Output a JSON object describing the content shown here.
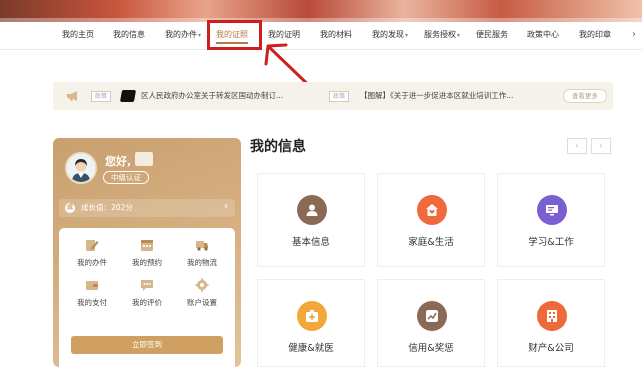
{
  "nav": {
    "items": [
      {
        "label": "我的主页",
        "dropdown": false
      },
      {
        "label": "我的信息",
        "dropdown": false
      },
      {
        "label": "我的办件",
        "dropdown": true
      },
      {
        "label": "我的证照",
        "dropdown": false,
        "active": true
      },
      {
        "label": "我的证明",
        "dropdown": false
      },
      {
        "label": "我的材料",
        "dropdown": false
      },
      {
        "label": "我的发现",
        "dropdown": true
      },
      {
        "label": "服务授权",
        "dropdown": true
      },
      {
        "label": "便民服务",
        "dropdown": false
      },
      {
        "label": "政策中心",
        "dropdown": false
      },
      {
        "label": "我的印章",
        "dropdown": false
      }
    ],
    "next": "›"
  },
  "notice": {
    "items": [
      {
        "tag": "政策",
        "text": "区人民政府办公室关于转发区国动办制订..."
      },
      {
        "tag": "政策",
        "text": "【图解】《关于进一步促进本区就业培训工作..."
      }
    ],
    "more": "查看更多"
  },
  "profile": {
    "greeting": "您好,",
    "level": "中级认证",
    "growth_icon": "成",
    "growth": "成长值：202分",
    "panel_items": [
      {
        "label": "我的办件",
        "icon": "edit-icon"
      },
      {
        "label": "我的预约",
        "icon": "calendar-icon"
      },
      {
        "label": "我的物流",
        "icon": "truck-icon"
      },
      {
        "label": "我的支付",
        "icon": "wallet-icon"
      },
      {
        "label": "我的评价",
        "icon": "comment-icon"
      },
      {
        "label": "账户设置",
        "icon": "gear-icon"
      }
    ],
    "sign_label": "立即签到"
  },
  "info": {
    "title": "我的信息",
    "prev": "‹",
    "next": "›",
    "tiles": [
      {
        "label": "基本信息",
        "icon": "user-icon",
        "color": "#8a6a55"
      },
      {
        "label": "家庭&生活",
        "icon": "home-icon",
        "color": "#ef6a3a"
      },
      {
        "label": "学习&工作",
        "icon": "monitor-icon",
        "color": "#7a5fd0"
      },
      {
        "label": "健康&就医",
        "icon": "medkit-icon",
        "color": "#f2a83a"
      },
      {
        "label": "信用&奖惩",
        "icon": "chart-icon",
        "color": "#8a6a55"
      },
      {
        "label": "财产&公司",
        "icon": "building-icon",
        "color": "#ee6a3a"
      }
    ]
  },
  "colors": {
    "accent": "#b0793e",
    "highlight": "#cc2020",
    "card": "#d3ab7c"
  }
}
